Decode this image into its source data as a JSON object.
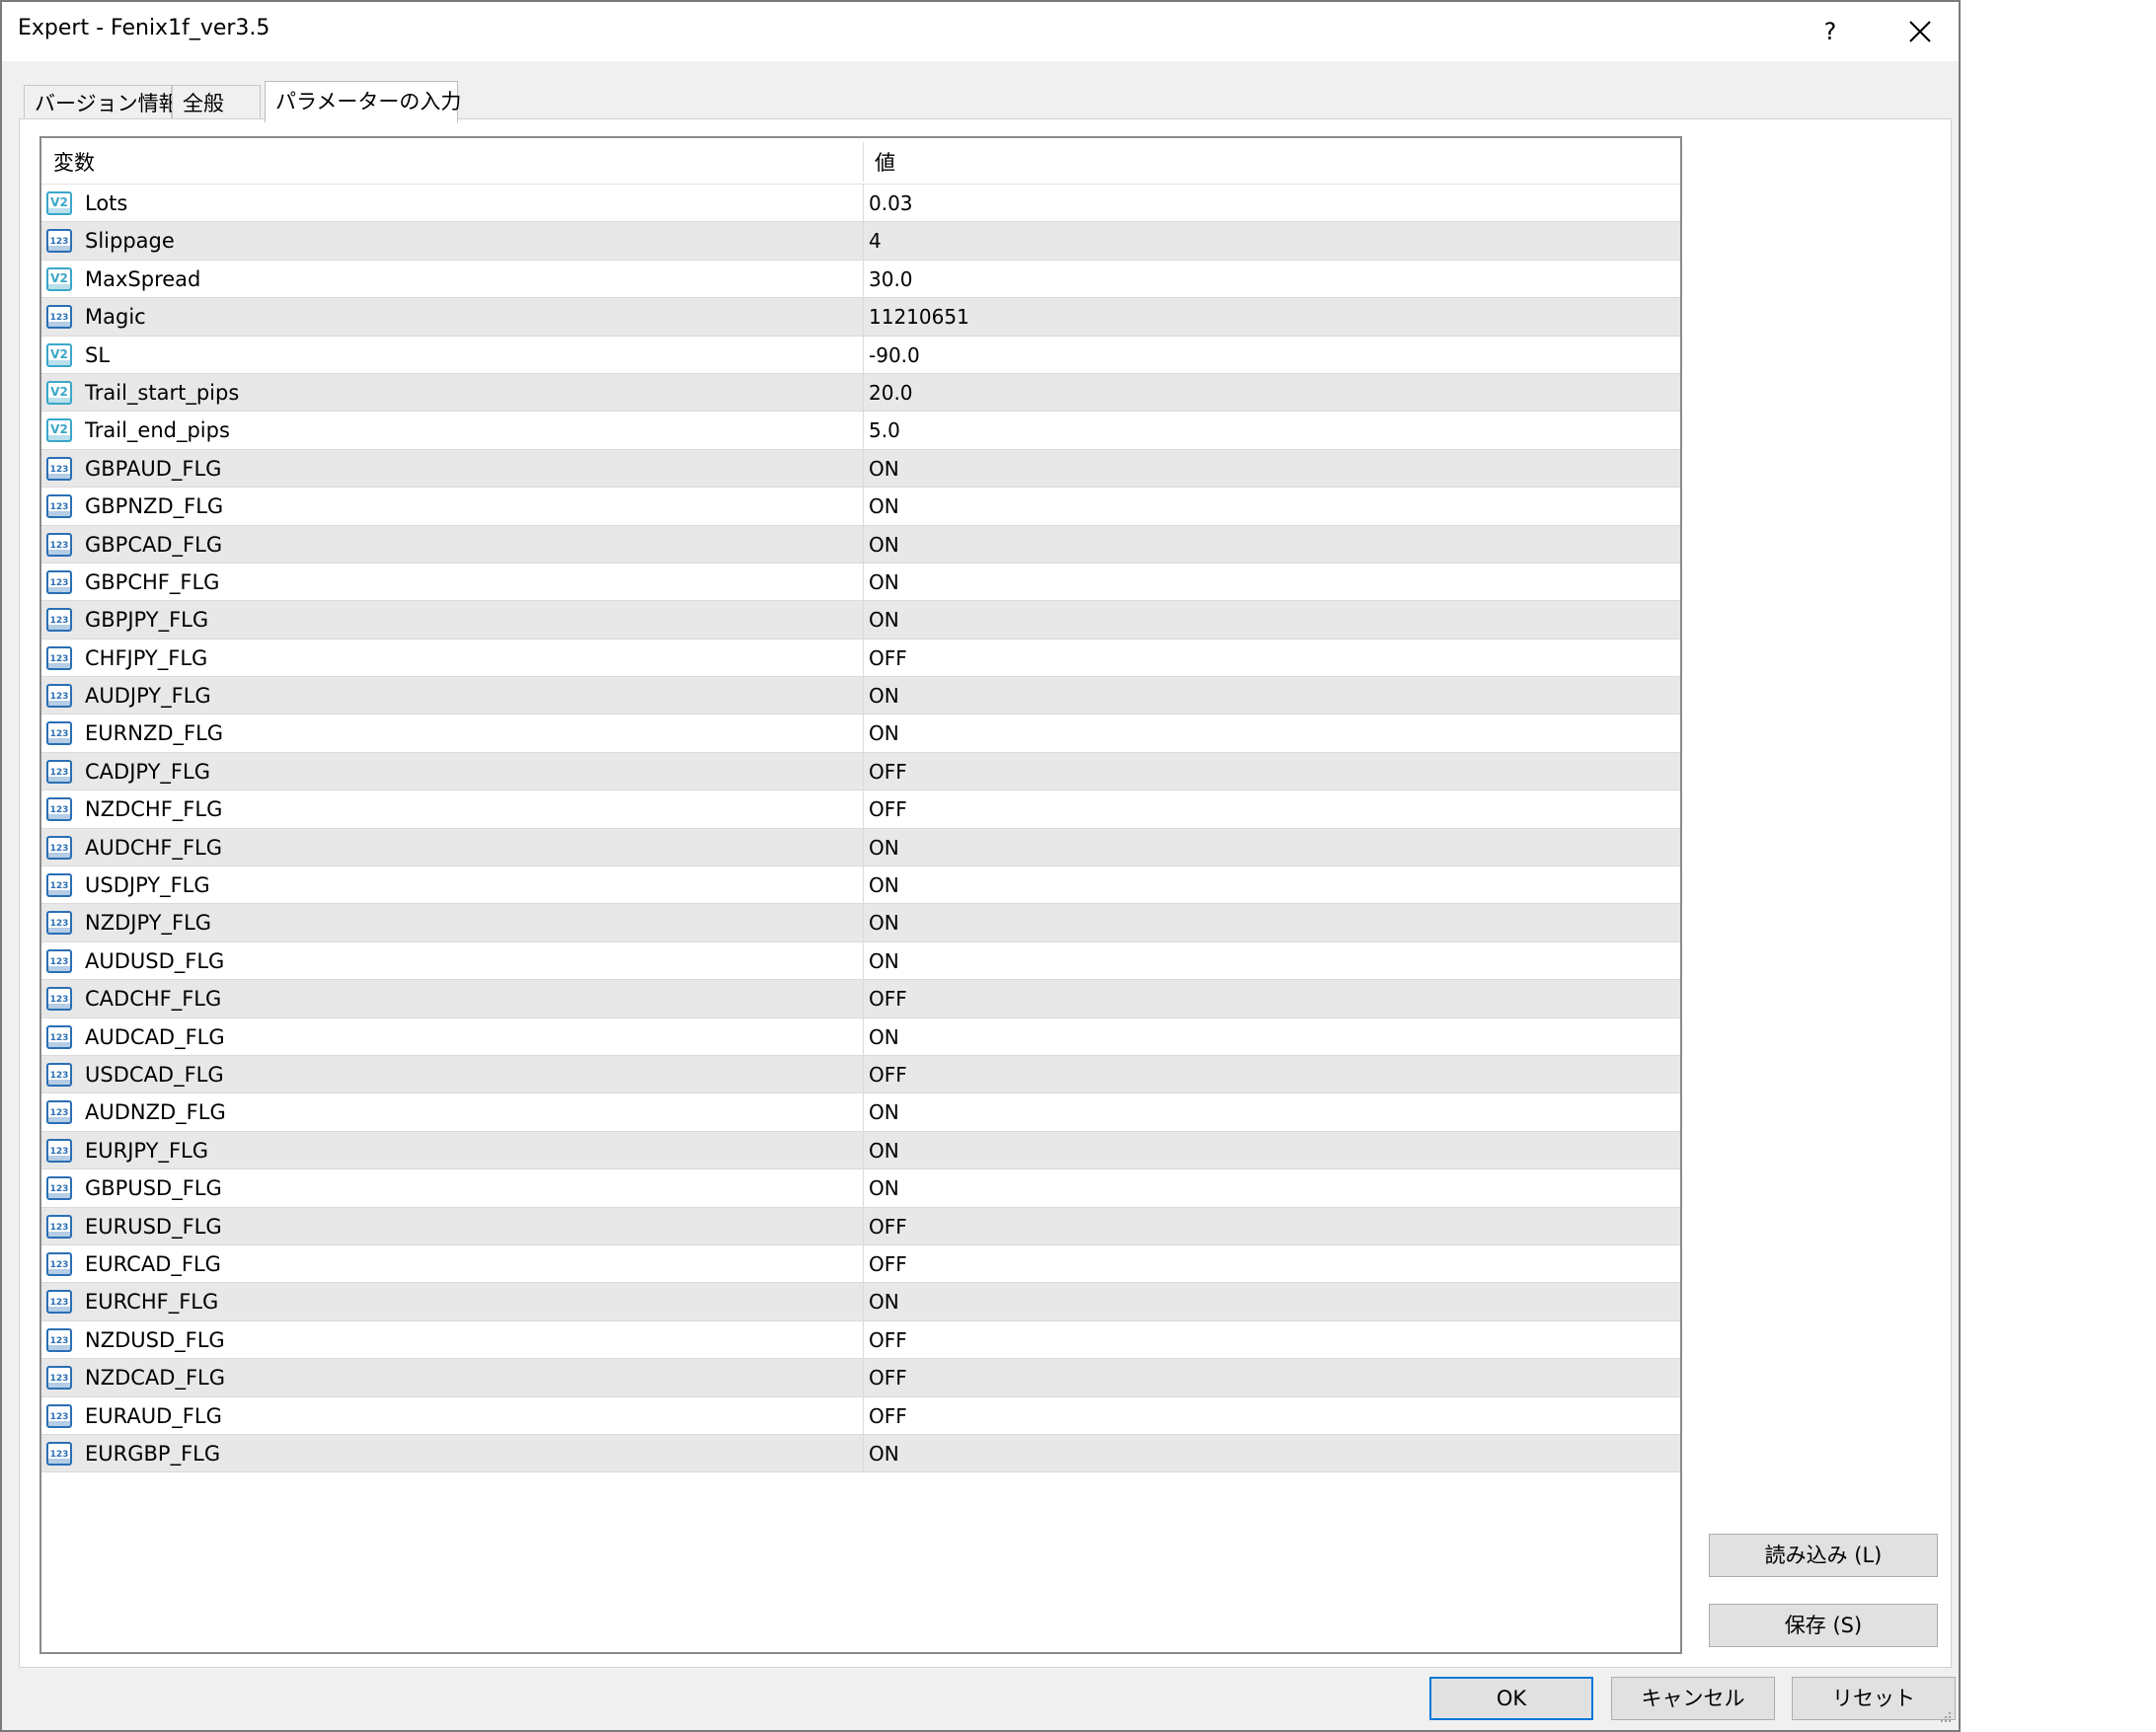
{
  "window": {
    "title": "Expert - Fenix1f_ver3.5",
    "help_label": "?"
  },
  "tabs": [
    {
      "label": "バージョン情報"
    },
    {
      "label": "全般"
    },
    {
      "label": "パラメーターの入力"
    }
  ],
  "table": {
    "headers": {
      "variable": "変数",
      "value": "値"
    },
    "rows": [
      {
        "name": "Lots",
        "value": "0.03",
        "icon": "double-value-icon"
      },
      {
        "name": "Slippage",
        "value": "4",
        "icon": "integer-value-icon"
      },
      {
        "name": "MaxSpread",
        "value": "30.0",
        "icon": "double-value-icon"
      },
      {
        "name": "Magic",
        "value": "11210651",
        "icon": "integer-value-icon"
      },
      {
        "name": "SL",
        "value": "-90.0",
        "icon": "double-value-icon"
      },
      {
        "name": "Trail_start_pips",
        "value": "20.0",
        "icon": "double-value-icon"
      },
      {
        "name": "Trail_end_pips",
        "value": "5.0",
        "icon": "double-value-icon"
      },
      {
        "name": "GBPAUD_FLG",
        "value": "ON",
        "icon": "integer-value-icon"
      },
      {
        "name": "GBPNZD_FLG",
        "value": "ON",
        "icon": "integer-value-icon"
      },
      {
        "name": "GBPCAD_FLG",
        "value": "ON",
        "icon": "integer-value-icon"
      },
      {
        "name": "GBPCHF_FLG",
        "value": "ON",
        "icon": "integer-value-icon"
      },
      {
        "name": "GBPJPY_FLG",
        "value": "ON",
        "icon": "integer-value-icon"
      },
      {
        "name": "CHFJPY_FLG",
        "value": "OFF",
        "icon": "integer-value-icon"
      },
      {
        "name": "AUDJPY_FLG",
        "value": "ON",
        "icon": "integer-value-icon"
      },
      {
        "name": "EURNZD_FLG",
        "value": "ON",
        "icon": "integer-value-icon"
      },
      {
        "name": "CADJPY_FLG",
        "value": "OFF",
        "icon": "integer-value-icon"
      },
      {
        "name": "NZDCHF_FLG",
        "value": "OFF",
        "icon": "integer-value-icon"
      },
      {
        "name": "AUDCHF_FLG",
        "value": "ON",
        "icon": "integer-value-icon"
      },
      {
        "name": "USDJPY_FLG",
        "value": "ON",
        "icon": "integer-value-icon"
      },
      {
        "name": "NZDJPY_FLG",
        "value": "ON",
        "icon": "integer-value-icon"
      },
      {
        "name": "AUDUSD_FLG",
        "value": "ON",
        "icon": "integer-value-icon"
      },
      {
        "name": "CADCHF_FLG",
        "value": "OFF",
        "icon": "integer-value-icon"
      },
      {
        "name": "AUDCAD_FLG",
        "value": "ON",
        "icon": "integer-value-icon"
      },
      {
        "name": "USDCAD_FLG",
        "value": "OFF",
        "icon": "integer-value-icon"
      },
      {
        "name": "AUDNZD_FLG",
        "value": "ON",
        "icon": "integer-value-icon"
      },
      {
        "name": "EURJPY_FLG",
        "value": "ON",
        "icon": "integer-value-icon"
      },
      {
        "name": "GBPUSD_FLG",
        "value": "ON",
        "icon": "integer-value-icon"
      },
      {
        "name": "EURUSD_FLG",
        "value": "OFF",
        "icon": "integer-value-icon"
      },
      {
        "name": "EURCAD_FLG",
        "value": "OFF",
        "icon": "integer-value-icon"
      },
      {
        "name": "EURCHF_FLG",
        "value": "ON",
        "icon": "integer-value-icon"
      },
      {
        "name": "NZDUSD_FLG",
        "value": "OFF",
        "icon": "integer-value-icon"
      },
      {
        "name": "NZDCAD_FLG",
        "value": "OFF",
        "icon": "integer-value-icon"
      },
      {
        "name": "EURAUD_FLG",
        "value": "OFF",
        "icon": "integer-value-icon"
      },
      {
        "name": "EURGBP_FLG",
        "value": "ON",
        "icon": "integer-value-icon"
      }
    ]
  },
  "buttons": {
    "load": "読み込み (L)",
    "save": "保存 (S)",
    "ok": "OK",
    "cancel": "キャンセル",
    "reset": "リセット"
  },
  "colors": {
    "accent": "#0078d7",
    "icon_double": "#3aa7c9",
    "icon_integer": "#2a6fb5"
  }
}
